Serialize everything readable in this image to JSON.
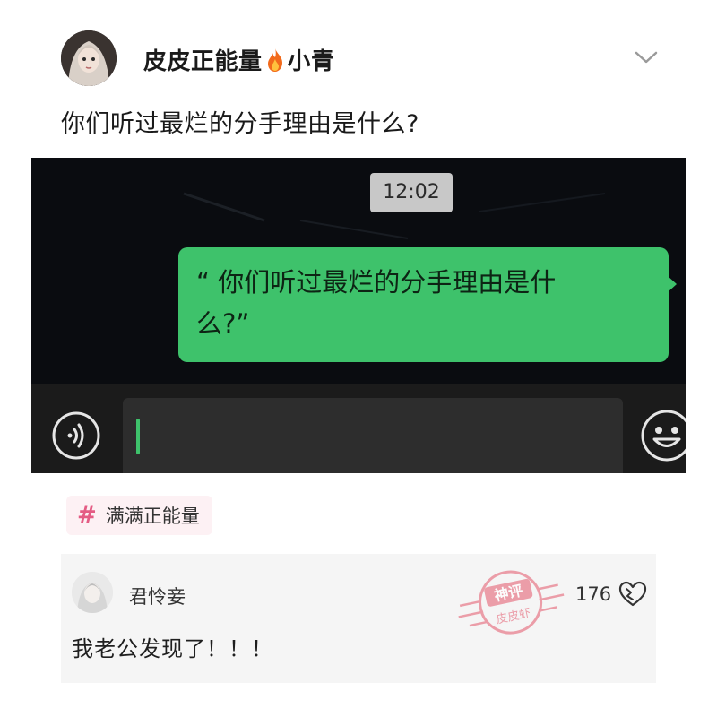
{
  "post": {
    "author": "皮皮正能量",
    "author_suffix": "小青",
    "title": "你们听过最烂的分手理由是什么?"
  },
  "screenshot": {
    "time": "12:02",
    "bubble_line1": "“ 你们听过最烂的分手理由是什",
    "bubble_line2": "么?”"
  },
  "topic": {
    "hash": "#",
    "label": "满满正能量"
  },
  "comment": {
    "name": "君怜妾",
    "text": "我老公发现了！！！",
    "likes": "176"
  },
  "stamp_text": [
    "神评",
    "皮皮虾"
  ],
  "icons": {
    "author_badge": "fire-icon",
    "more": "chevron-down-icon",
    "voice": "voice-icon",
    "emoji": "emoji-icon",
    "like": "heart-like-icon"
  },
  "colors": {
    "bubble": "#3ec26b",
    "topic_hash": "#e45c84",
    "stamp": "#e8808f"
  }
}
